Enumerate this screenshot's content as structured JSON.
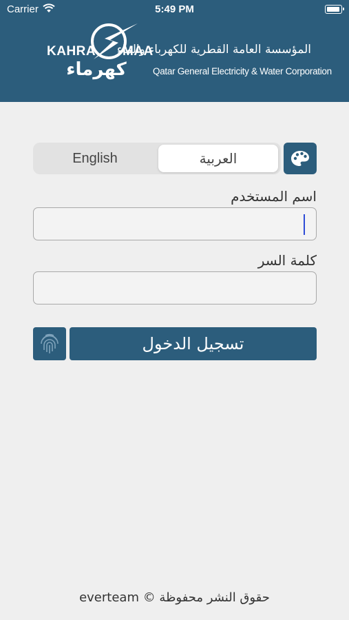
{
  "status_bar": {
    "carrier": "Carrier",
    "time": "5:49 PM"
  },
  "header": {
    "background_color": "#2c5d7c",
    "logo": {
      "kahra": "KAHRA",
      "maa": "MAA",
      "arabic_short": "كهرماء",
      "arabic_full": "المؤسسة العامة القطرية للكهرباء والماء",
      "english_full": "Qatar General Electricity & Water Corporation"
    }
  },
  "language_toggle": {
    "english": "English",
    "arabic": "العربية",
    "selected": "arabic"
  },
  "theme_button": {
    "icon": "palette-icon"
  },
  "form": {
    "username_label": "اسم المستخدم",
    "username_value": "",
    "password_label": "كلمة السر",
    "password_value": ""
  },
  "login_button": {
    "label": "تسجيل الدخول"
  },
  "fingerprint_button": {
    "icon": "fingerprint-icon"
  },
  "footer": {
    "copyright": "حقوق النشر محفوظة © everteam"
  },
  "colors": {
    "primary": "#2c5d7c",
    "background": "#efefef",
    "caret": "#2d4bd6"
  }
}
